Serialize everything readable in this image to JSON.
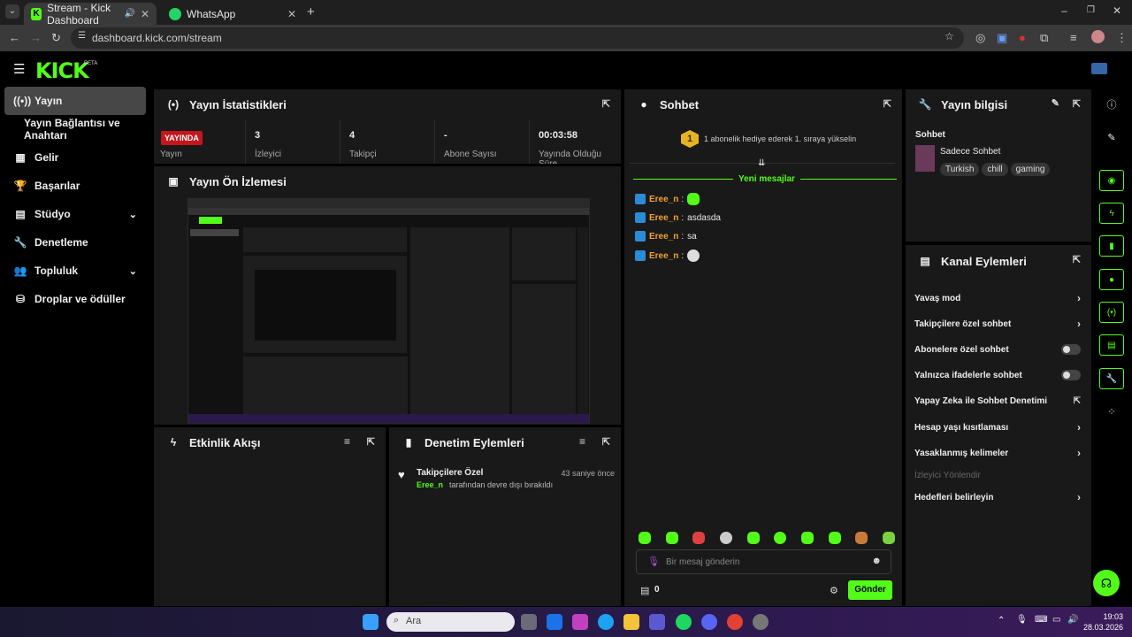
{
  "browser": {
    "tabs": [
      {
        "title": "Stream - Kick Dashboard",
        "active": true
      },
      {
        "title": "WhatsApp",
        "active": false
      }
    ],
    "url": "dashboard.kick.com/stream"
  },
  "app": {
    "logo": "KICK",
    "logo_badge": "BETA"
  },
  "sidebar": {
    "items": [
      {
        "label": "Yayın",
        "icon": "broadcast-icon",
        "active": true
      },
      {
        "label": "Yayın Bağlantısı ve Anahtarı",
        "icon": "",
        "active": false
      },
      {
        "label": "Gelir",
        "icon": "revenue-icon",
        "active": false
      },
      {
        "label": "Başarılar",
        "icon": "trophy-icon",
        "active": false
      },
      {
        "label": "Stüdyo",
        "icon": "studio-icon",
        "active": false,
        "expandable": true
      },
      {
        "label": "Denetleme",
        "icon": "wrench-icon",
        "active": false
      },
      {
        "label": "Topluluk",
        "icon": "community-icon",
        "active": false,
        "expandable": true
      },
      {
        "label": "Droplar ve ödüller",
        "icon": "gift-icon",
        "active": false
      }
    ]
  },
  "stats": {
    "title": "Yayın İstatistikleri",
    "live_badge": "YAYINDA",
    "cells": [
      {
        "value": "",
        "label": "Yayın"
      },
      {
        "value": "3",
        "label": "İzleyici"
      },
      {
        "value": "4",
        "label": "Takipçi"
      },
      {
        "value": "-",
        "label": "Abone Sayısı"
      },
      {
        "value": "00:03:58",
        "label": "Yayında Olduğu Süre"
      }
    ]
  },
  "preview": {
    "title": "Yayın Ön İzlemesi"
  },
  "activity": {
    "title": "Etkinlik Akışı"
  },
  "moderation": {
    "title": "Denetim Eylemleri",
    "entries": [
      {
        "title": "Takipçilere Özel",
        "user": "Eree_n",
        "text": "tarafından devre dışı bırakıldı",
        "time": "43 saniye önce"
      }
    ]
  },
  "chat": {
    "title": "Sohbet",
    "notice_rank": "1",
    "notice": "1 abonelik hediye ederek 1. sıraya yükselin",
    "new_messages": "Yeni mesajlar",
    "messages": [
      {
        "user": "Eree_n",
        "text": "",
        "emote": true
      },
      {
        "user": "Eree_n",
        "text": "asdasda",
        "emote": false
      },
      {
        "user": "Eree_n",
        "text": "sa",
        "emote": false
      },
      {
        "user": "Eree_n",
        "text": "",
        "emote": true
      }
    ],
    "input_placeholder": "Bir mesaj gönderin",
    "points": "0",
    "send_label": "Gönder"
  },
  "stream_info": {
    "title": "Yayın bilgisi",
    "section_label": "Sohbet",
    "stream_title": "Sadece Sohbet",
    "tags": [
      "Turkish",
      "chill",
      "gaming"
    ]
  },
  "channel_actions": {
    "title": "Kanal Eylemleri",
    "items": [
      {
        "label": "Yavaş mod",
        "control": "arrow"
      },
      {
        "label": "Takipçilere özel sohbet",
        "control": "arrow"
      },
      {
        "label": "Abonelere özel sohbet",
        "control": "toggle"
      },
      {
        "label": "Yalnızca ifadelerle sohbet",
        "control": "toggle"
      },
      {
        "label": "Yapay Zeka ile Sohbet Denetimi",
        "control": "external"
      },
      {
        "label": "Hesap yaşı kısıtlaması",
        "control": "arrow"
      },
      {
        "label": "Yasaklanmış kelimeler",
        "control": "arrow"
      },
      {
        "label": "İzleyici Yönlendir",
        "control": "none",
        "disabled": true
      },
      {
        "label": "Hedefleri belirleyin",
        "control": "arrow"
      }
    ]
  },
  "taskbar": {
    "search_placeholder": "Ara",
    "time": "19:03",
    "date": "28.03.2026"
  }
}
